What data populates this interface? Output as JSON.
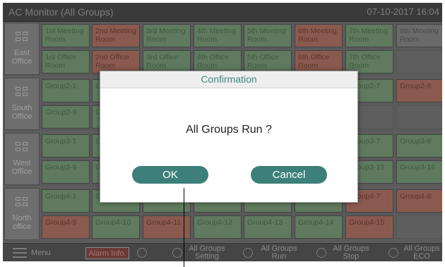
{
  "window": {
    "title": "AC Monitor (All Groups)",
    "datetime": "07-10-2017  16:04"
  },
  "groups": [
    {
      "label": "East\nOffice",
      "rows": [
        [
          {
            "t": "1st Meeting Room",
            "c": "green"
          },
          {
            "t": "2nd Meeting Room",
            "c": "red"
          },
          {
            "t": "3rd Meeting Room",
            "c": "green"
          },
          {
            "t": "4th Meeting Room",
            "c": "green"
          },
          {
            "t": "5th Meeting Room",
            "c": "green"
          },
          {
            "t": "6th Meeting Room",
            "c": "red"
          },
          {
            "t": "7th Meeting Room",
            "c": "green"
          },
          {
            "t": "8th Meeting Room",
            "c": "gray"
          }
        ],
        [
          {
            "t": "1st Office Room",
            "c": "green"
          },
          {
            "t": "2nd Office Room",
            "c": "red"
          },
          {
            "t": "3rd Office Room",
            "c": "green"
          },
          {
            "t": "4th Office Room",
            "c": "green"
          },
          {
            "t": "5th Office Room",
            "c": "green"
          },
          {
            "t": "6th Office Room",
            "c": "red"
          },
          {
            "t": "7th Office Room",
            "c": "green"
          },
          {
            "t": "",
            "c": "empty"
          }
        ]
      ]
    },
    {
      "label": "South\nOffice",
      "rows": [
        [
          {
            "t": "Group2-1",
            "c": "green"
          },
          {
            "t": "Gr",
            "c": "green"
          },
          {
            "t": "",
            "c": "green"
          },
          {
            "t": "",
            "c": "green"
          },
          {
            "t": "",
            "c": "green"
          },
          {
            "t": "",
            "c": "green"
          },
          {
            "t": "Group2-7",
            "c": "green"
          },
          {
            "t": "Group2-8",
            "c": "red"
          }
        ],
        [
          {
            "t": "Group2-9",
            "c": "green"
          },
          {
            "t": "Gr",
            "c": "green"
          },
          {
            "t": "",
            "c": "green"
          },
          {
            "t": "",
            "c": "green"
          },
          {
            "t": "",
            "c": "green"
          },
          {
            "t": "",
            "c": "green"
          },
          {
            "t": "",
            "c": "empty"
          },
          {
            "t": "",
            "c": "empty"
          }
        ]
      ]
    },
    {
      "label": "West\nOffice",
      "rows": [
        [
          {
            "t": "Group3-1",
            "c": "green"
          },
          {
            "t": "Gr",
            "c": "green"
          },
          {
            "t": "",
            "c": "green"
          },
          {
            "t": "",
            "c": "green"
          },
          {
            "t": "",
            "c": "green"
          },
          {
            "t": "",
            "c": "green"
          },
          {
            "t": "Group3-7",
            "c": "green"
          },
          {
            "t": "Group3-8",
            "c": "green"
          }
        ],
        [
          {
            "t": "Group3-9",
            "c": "green"
          },
          {
            "t": "Gr",
            "c": "green"
          },
          {
            "t": "",
            "c": "green"
          },
          {
            "t": "",
            "c": "green"
          },
          {
            "t": "",
            "c": "green"
          },
          {
            "t": "",
            "c": "green"
          },
          {
            "t": "Group3-15",
            "c": "green"
          },
          {
            "t": "Group3-16",
            "c": "green"
          }
        ]
      ]
    },
    {
      "label": "North\noffice",
      "rows": [
        [
          {
            "t": "Group4-1",
            "c": "green"
          },
          {
            "t": "Gr",
            "c": "green"
          },
          {
            "t": "",
            "c": "green"
          },
          {
            "t": "",
            "c": "green"
          },
          {
            "t": "",
            "c": "green"
          },
          {
            "t": "",
            "c": "green"
          },
          {
            "t": "Group4-7",
            "c": "red"
          },
          {
            "t": "Group4-8",
            "c": "red"
          }
        ],
        [
          {
            "t": "Group4-9",
            "c": "red"
          },
          {
            "t": "Group4-10",
            "c": "green"
          },
          {
            "t": "Group4-11",
            "c": "red"
          },
          {
            "t": "Group4-12",
            "c": "green"
          },
          {
            "t": "Group4-13",
            "c": "green"
          },
          {
            "t": "Group4-14",
            "c": "green"
          },
          {
            "t": "Group4-15",
            "c": "red"
          },
          {
            "t": "",
            "c": "empty"
          }
        ]
      ]
    }
  ],
  "bottombar": {
    "menu": "Menu",
    "alarm": "Alarm Info.",
    "settings": "All Groups\nSetting",
    "run": "All Groups\nRun",
    "stop": "All Groups\nStop",
    "eco": "All Groups\nECO"
  },
  "dialog": {
    "title": "Confirmation",
    "message": "All Groups Run ?",
    "ok": "OK",
    "cancel": "Cancel"
  }
}
